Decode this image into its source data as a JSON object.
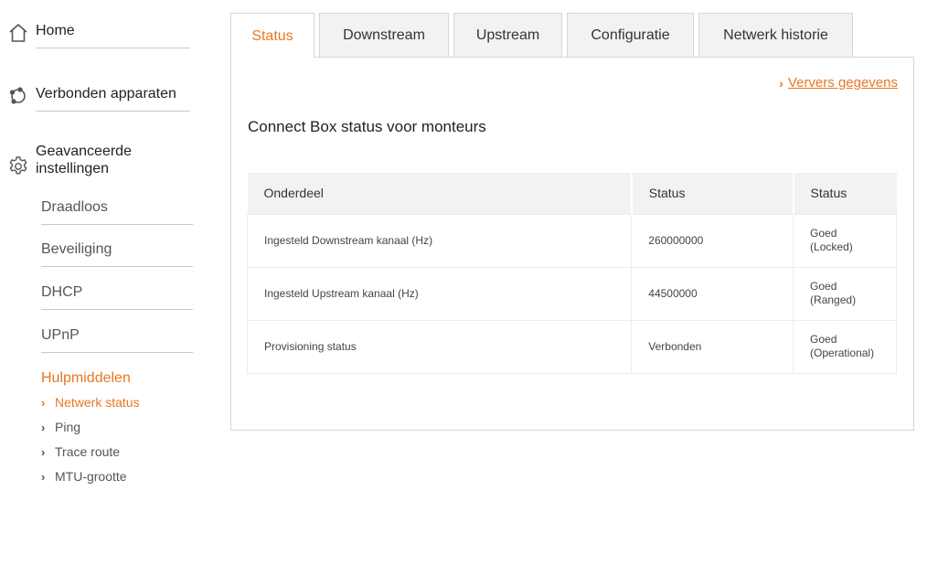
{
  "sidebar": {
    "home": {
      "label": "Home",
      "icon": "home-icon"
    },
    "devices": {
      "label": "Verbonden apparaten",
      "icon": "devices-icon"
    },
    "advanced": {
      "label_line1": "Geavanceerde",
      "label_line2": "instellingen",
      "icon": "gear-icon"
    },
    "sub_items": [
      {
        "label": "Draadloos"
      },
      {
        "label": "Beveiliging"
      },
      {
        "label": "DHCP"
      },
      {
        "label": "UPnP"
      }
    ],
    "tools_heading": "Hulpmiddelen",
    "tools": [
      {
        "label": "Netwerk status",
        "active": true
      },
      {
        "label": "Ping",
        "active": false
      },
      {
        "label": "Trace route",
        "active": false
      },
      {
        "label": "MTU-grootte",
        "active": false
      }
    ]
  },
  "tabs": [
    {
      "label": "Status",
      "active": true
    },
    {
      "label": "Downstream",
      "active": false
    },
    {
      "label": "Upstream",
      "active": false
    },
    {
      "label": "Configuratie",
      "active": false
    },
    {
      "label": "Netwerk historie",
      "active": false
    }
  ],
  "panel": {
    "refresh_label": "Ververs gegevens",
    "title": "Connect Box status voor monteurs",
    "table": {
      "headers": [
        "Onderdeel",
        "Status",
        "Status"
      ],
      "rows": [
        {
          "item": "Ingesteld Downstream kanaal (Hz)",
          "value": "260000000",
          "status_line1": "Goed",
          "status_line2": "(Locked)"
        },
        {
          "item": "Ingesteld Upstream kanaal (Hz)",
          "value": "44500000",
          "status_line1": "Goed",
          "status_line2": "(Ranged)"
        },
        {
          "item": "Provisioning status",
          "value": "Verbonden",
          "status_line1": "Goed",
          "status_line2": "(Operational)"
        }
      ]
    }
  },
  "colors": {
    "accent": "#e87722",
    "tab_inactive_bg": "#f2f2f2",
    "border": "#d6d6d6"
  }
}
